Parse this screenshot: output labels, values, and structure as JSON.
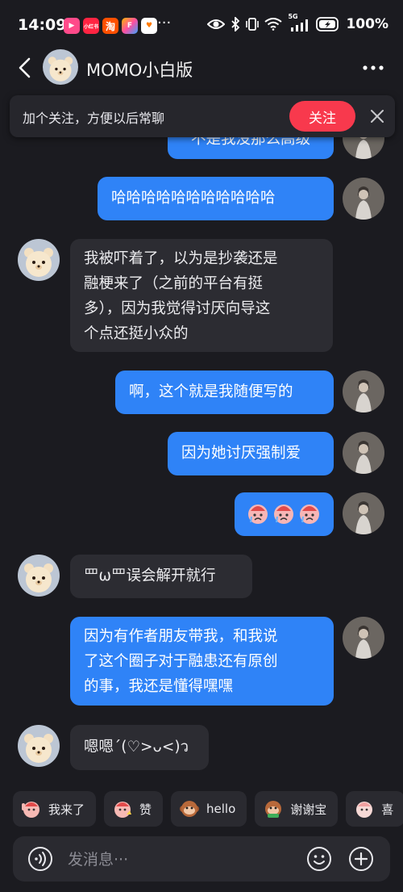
{
  "status": {
    "time": "14:09",
    "apps": [
      "▶",
      "小红书",
      "淘",
      "F",
      "♥"
    ],
    "more": "···",
    "battery": "100%",
    "network": "5G"
  },
  "header": {
    "title": "MOMO小白版"
  },
  "follow_banner": {
    "text": "加个关注，方便以后常聊",
    "button": "关注"
  },
  "messages": [
    {
      "from": "me",
      "lines": [
        "不是我没那么高级"
      ]
    },
    {
      "from": "me",
      "lines": [
        "哈哈哈哈哈哈哈哈哈哈哈"
      ]
    },
    {
      "from": "them",
      "lines": [
        "我被吓着了，以为是抄袭还是",
        "融梗来了（之前的平台有挺",
        "多），因为我觉得讨厌向导这",
        "个点还挺小众的"
      ]
    },
    {
      "from": "me",
      "lines": [
        "啊，这个就是我随便写的"
      ]
    },
    {
      "from": "me",
      "lines": [
        "因为她讨厌强制爱"
      ]
    },
    {
      "from": "me",
      "lines": [
        "[sticker][sticker][sticker]"
      ]
    },
    {
      "from": "them",
      "lines": [
        "罒ω罒误会解开就行"
      ]
    },
    {
      "from": "me",
      "lines": [
        "因为有作者朋友带我，和我说",
        "了这个圈子对于融患还有原创",
        "的事，我还是懂得嘿嘿"
      ]
    },
    {
      "from": "them",
      "lines": [
        "嗯嗯ˊ(♡>ᴗ<)ว"
      ]
    }
  ],
  "quick_replies": [
    "我来了",
    "赞",
    "hello",
    "谢谢宝",
    "喜"
  ],
  "input": {
    "placeholder": "发消息···"
  },
  "colors": {
    "background": "#1b1b20",
    "outgoing_bubble": "#2f83f7",
    "incoming_bubble": "#2c2c32",
    "follow_button": "#f8394d"
  }
}
